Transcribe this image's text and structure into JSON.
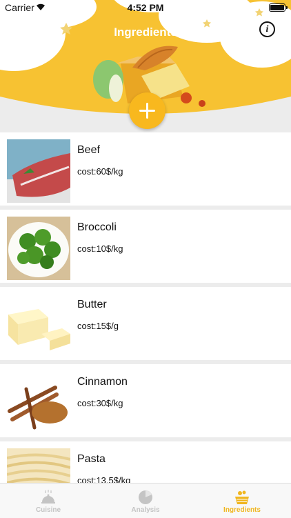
{
  "status_bar": {
    "carrier": "Carrier",
    "time": "4:52 PM"
  },
  "header": {
    "title": "Ingredients",
    "info_label": "i"
  },
  "ingredients": [
    {
      "name": "Beef",
      "cost": "cost:60$/kg"
    },
    {
      "name": "Broccoli",
      "cost": "cost:10$/kg"
    },
    {
      "name": "Butter",
      "cost": "cost:15$/g"
    },
    {
      "name": "Cinnamon",
      "cost": "cost:30$/kg"
    },
    {
      "name": "Pasta",
      "cost": "cost:13.5$/kg"
    }
  ],
  "tabs": [
    {
      "label": "Cuisine",
      "icon": "cloche-icon",
      "active": false
    },
    {
      "label": "Analysis",
      "icon": "pie-chart-icon",
      "active": false
    },
    {
      "label": "Ingredients",
      "icon": "basket-icon",
      "active": true
    }
  ],
  "colors": {
    "accent": "#f8b81e",
    "header_bg": "#f7c232",
    "tab_inactive": "#c4c4c4",
    "tab_active": "#f0b620"
  }
}
